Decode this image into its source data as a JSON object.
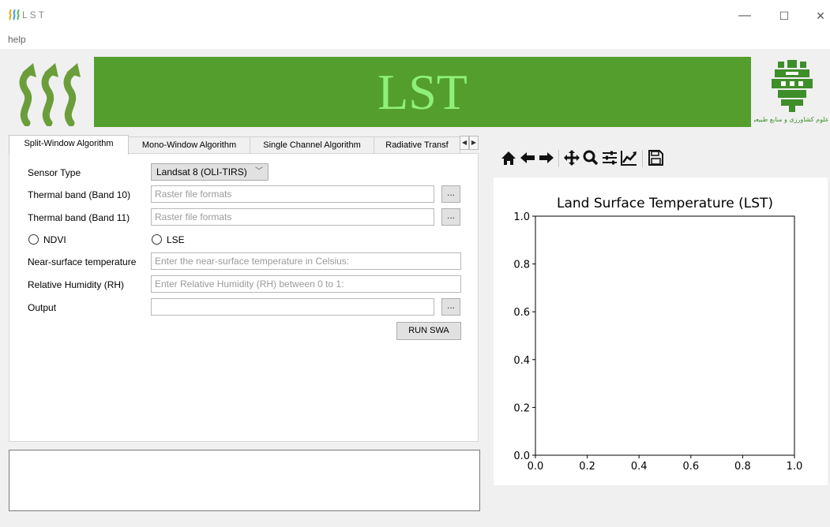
{
  "window": {
    "title": "LST",
    "minimize": "—",
    "maximize": "☐",
    "close": "✕"
  },
  "menu": {
    "help": "help"
  },
  "banner": {
    "title": "LST",
    "color": "#549e2d",
    "text_color": "#8ef07a"
  },
  "logos": {
    "left": "heat-waves-logo-icon",
    "right": "university-logo-icon",
    "right_caption": "دانشگاه علوم کشاورزی و منابع طبیعی گرگان"
  },
  "tabs": [
    {
      "label": "Split-Window Algorithm",
      "active": true
    },
    {
      "label": "Mono-Window Algorithm",
      "active": false
    },
    {
      "label": "Single Channel Algorithm",
      "active": false
    },
    {
      "label": "Radiative Transf",
      "active": false
    }
  ],
  "form": {
    "sensor_type_label": "Sensor Type",
    "sensor_type_value": "Landsat 8 (OLI-TIRS)",
    "band10_label": "Thermal band  (Band 10)",
    "band10_placeholder": "Raster file formats",
    "band11_label": "Thermal band   (Band 11)",
    "band11_placeholder": "Raster file formats",
    "browse_label": "...",
    "ndvi_label": "NDVI",
    "lse_label": "LSE",
    "near_surface_label": "Near-surface temperature",
    "near_surface_placeholder": "Enter the near-surface temperature in Celsius:",
    "rh_label": "Relative Humidity (RH)",
    "rh_placeholder": "Enter Relative Humidity (RH) between 0 to 1:",
    "output_label": "Output",
    "output_value": "",
    "run_label": "RUN SWA"
  },
  "toolbar": [
    "home-icon",
    "back-arrow-icon",
    "forward-arrow-icon",
    "pan-icon",
    "zoom-icon",
    "subplots-icon",
    "edit-axis-icon",
    "save-icon"
  ],
  "chart_data": {
    "type": "line",
    "title": "Land Surface Temperature (LST)",
    "xlabel": "",
    "ylabel": "",
    "xlim": [
      0.0,
      1.0
    ],
    "ylim": [
      0.0,
      1.0
    ],
    "xticks": [
      "0.0",
      "0.2",
      "0.4",
      "0.6",
      "0.8",
      "1.0"
    ],
    "yticks": [
      "0.0",
      "0.2",
      "0.4",
      "0.6",
      "0.8",
      "1.0"
    ],
    "series": [],
    "grid": false
  }
}
